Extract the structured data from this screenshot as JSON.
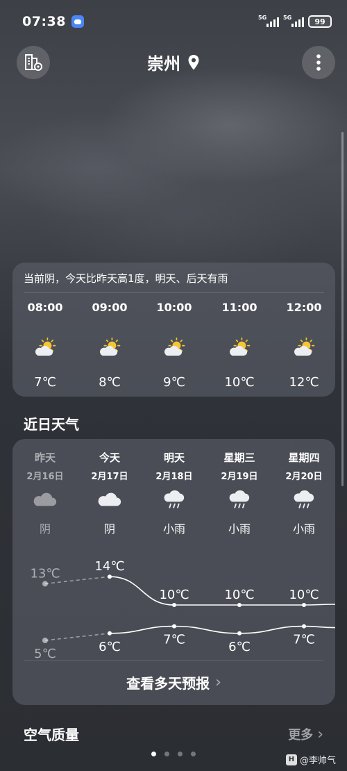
{
  "status_bar": {
    "time": "07:38",
    "net1": "5G",
    "net2": "5G",
    "battery": "99"
  },
  "header": {
    "city": "崇州"
  },
  "hourly": {
    "tip": "当前阴，今天比昨天高1度，明天、后天有雨",
    "items": [
      {
        "time": "08:00",
        "temp": "7℃",
        "icon": "partly-cloudy-sun-icon"
      },
      {
        "time": "09:00",
        "temp": "8℃",
        "icon": "partly-cloudy-sun-icon"
      },
      {
        "time": "10:00",
        "temp": "9℃",
        "icon": "partly-cloudy-sun-icon"
      },
      {
        "time": "11:00",
        "temp": "10℃",
        "icon": "partly-cloudy-sun-icon"
      },
      {
        "time": "12:00",
        "temp": "12℃",
        "icon": "partly-cloudy-sun-icon"
      }
    ]
  },
  "daily_title": "近日天气",
  "daily": {
    "days": [
      {
        "day": "昨天",
        "date": "2月16日",
        "cond": "阴",
        "icon": "cloud-icon",
        "high": 13,
        "low": 5,
        "high_label": "13℃",
        "low_label": "5℃",
        "past": true
      },
      {
        "day": "今天",
        "date": "2月17日",
        "cond": "阴",
        "icon": "cloud-icon",
        "high": 14,
        "low": 6,
        "high_label": "14℃",
        "low_label": "6℃",
        "past": false
      },
      {
        "day": "明天",
        "date": "2月18日",
        "cond": "小雨",
        "icon": "rain-icon",
        "high": 10,
        "low": 7,
        "high_label": "10℃",
        "low_label": "7℃",
        "past": false
      },
      {
        "day": "星期三",
        "date": "2月19日",
        "cond": "小雨",
        "icon": "rain-icon",
        "high": 10,
        "low": 6,
        "high_label": "10℃",
        "low_label": "6℃",
        "past": false
      },
      {
        "day": "星期四",
        "date": "2月20日",
        "cond": "小雨",
        "icon": "rain-icon",
        "high": 10,
        "low": 7,
        "high_label": "10℃",
        "low_label": "7℃",
        "past": false
      }
    ],
    "more_label": "查看多天预报"
  },
  "air_quality": {
    "title": "空气质量",
    "more": "更多"
  },
  "watermark": "@李帅气",
  "colors": {
    "sun": "#f7c531",
    "cloud": "#eceef2",
    "past_cloud": "#9a9ca2"
  }
}
